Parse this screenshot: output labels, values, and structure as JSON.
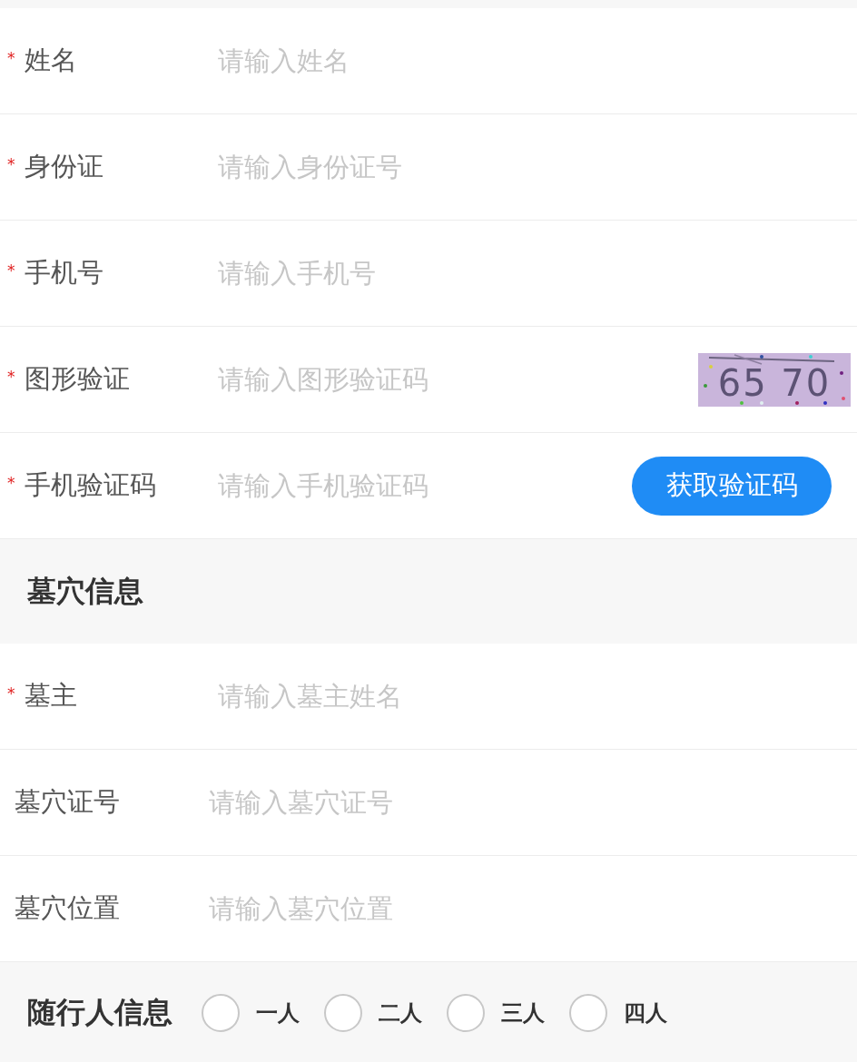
{
  "personal_fields": [
    {
      "kind": "text",
      "required_mark": "*",
      "label": "姓名",
      "placeholder": "请输入姓名"
    },
    {
      "kind": "text",
      "required_mark": "*",
      "label": "身份证",
      "placeholder": "请输入身份证号"
    },
    {
      "kind": "text",
      "required_mark": "*",
      "label": "手机号",
      "placeholder": "请输入手机号"
    },
    {
      "kind": "captcha",
      "required_mark": "*",
      "label": "图形验证",
      "placeholder": "请输入图形验证码",
      "captcha": "65 70"
    },
    {
      "kind": "sms",
      "required_mark": "*",
      "label": "手机验证码",
      "placeholder": "请输入手机验证码",
      "button": "获取验证码"
    }
  ],
  "grave_section": {
    "title": "墓穴信息",
    "fields": [
      {
        "kind": "text",
        "required_mark": "*",
        "label": "墓主",
        "placeholder": "请输入墓主姓名"
      },
      {
        "kind": "text",
        "label": "墓穴证号",
        "placeholder": "请输入墓穴证号"
      },
      {
        "kind": "text",
        "label": "墓穴位置",
        "placeholder": "请输入墓穴位置"
      }
    ]
  },
  "companions": {
    "title": "随行人信息",
    "options": [
      {
        "label": "一人",
        "selected": false
      },
      {
        "label": "二人",
        "selected": false
      },
      {
        "label": "三人",
        "selected": false
      },
      {
        "label": "四人",
        "selected": false
      }
    ]
  }
}
